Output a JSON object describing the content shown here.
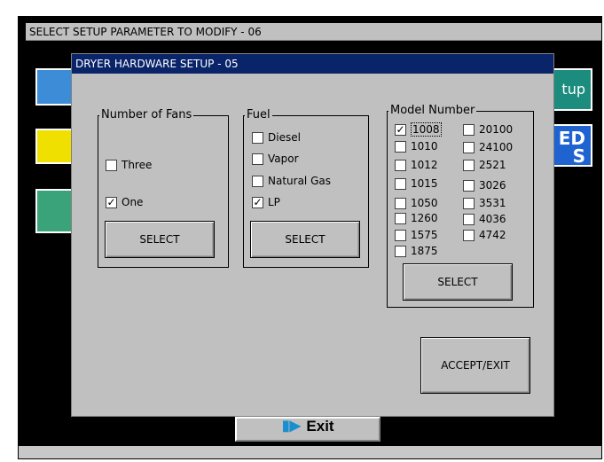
{
  "outer_title": "SELECT SETUP PARAMETER TO MODIFY - 06",
  "background_buttons": {
    "setup_partial_label": "tup",
    "ed_partial_label": "ED",
    "ed_partial_label_2": "S",
    "exit_label": "Exit"
  },
  "dialog": {
    "title": "DRYER HARDWARE SETUP - 05",
    "fans": {
      "caption": "Number of Fans",
      "options": [
        {
          "label": "Three",
          "checked": false
        },
        {
          "label": "One",
          "checked": true
        }
      ],
      "select_label": "SELECT"
    },
    "fuel": {
      "caption": "Fuel",
      "options": [
        {
          "label": "Diesel",
          "checked": false
        },
        {
          "label": "Vapor",
          "checked": false
        },
        {
          "label": "Natural Gas",
          "checked": false
        },
        {
          "label": "LP",
          "checked": true
        }
      ],
      "select_label": "SELECT"
    },
    "model": {
      "caption": "Model Number",
      "options": [
        {
          "label": "1008",
          "checked": true
        },
        {
          "label": "1010",
          "checked": false
        },
        {
          "label": "1012",
          "checked": false
        },
        {
          "label": "1015",
          "checked": false
        },
        {
          "label": "1050",
          "checked": false
        },
        {
          "label": "1260",
          "checked": false
        },
        {
          "label": "1575",
          "checked": false
        },
        {
          "label": "1875",
          "checked": false
        },
        {
          "label": "20100",
          "checked": false
        },
        {
          "label": "24100",
          "checked": false
        },
        {
          "label": "2521",
          "checked": false
        },
        {
          "label": "3026",
          "checked": false
        },
        {
          "label": "3531",
          "checked": false
        },
        {
          "label": "4036",
          "checked": false
        },
        {
          "label": "4742",
          "checked": false
        }
      ],
      "select_label": "SELECT"
    },
    "accept_label": "ACCEPT/EXIT"
  },
  "check_mark": "✓"
}
